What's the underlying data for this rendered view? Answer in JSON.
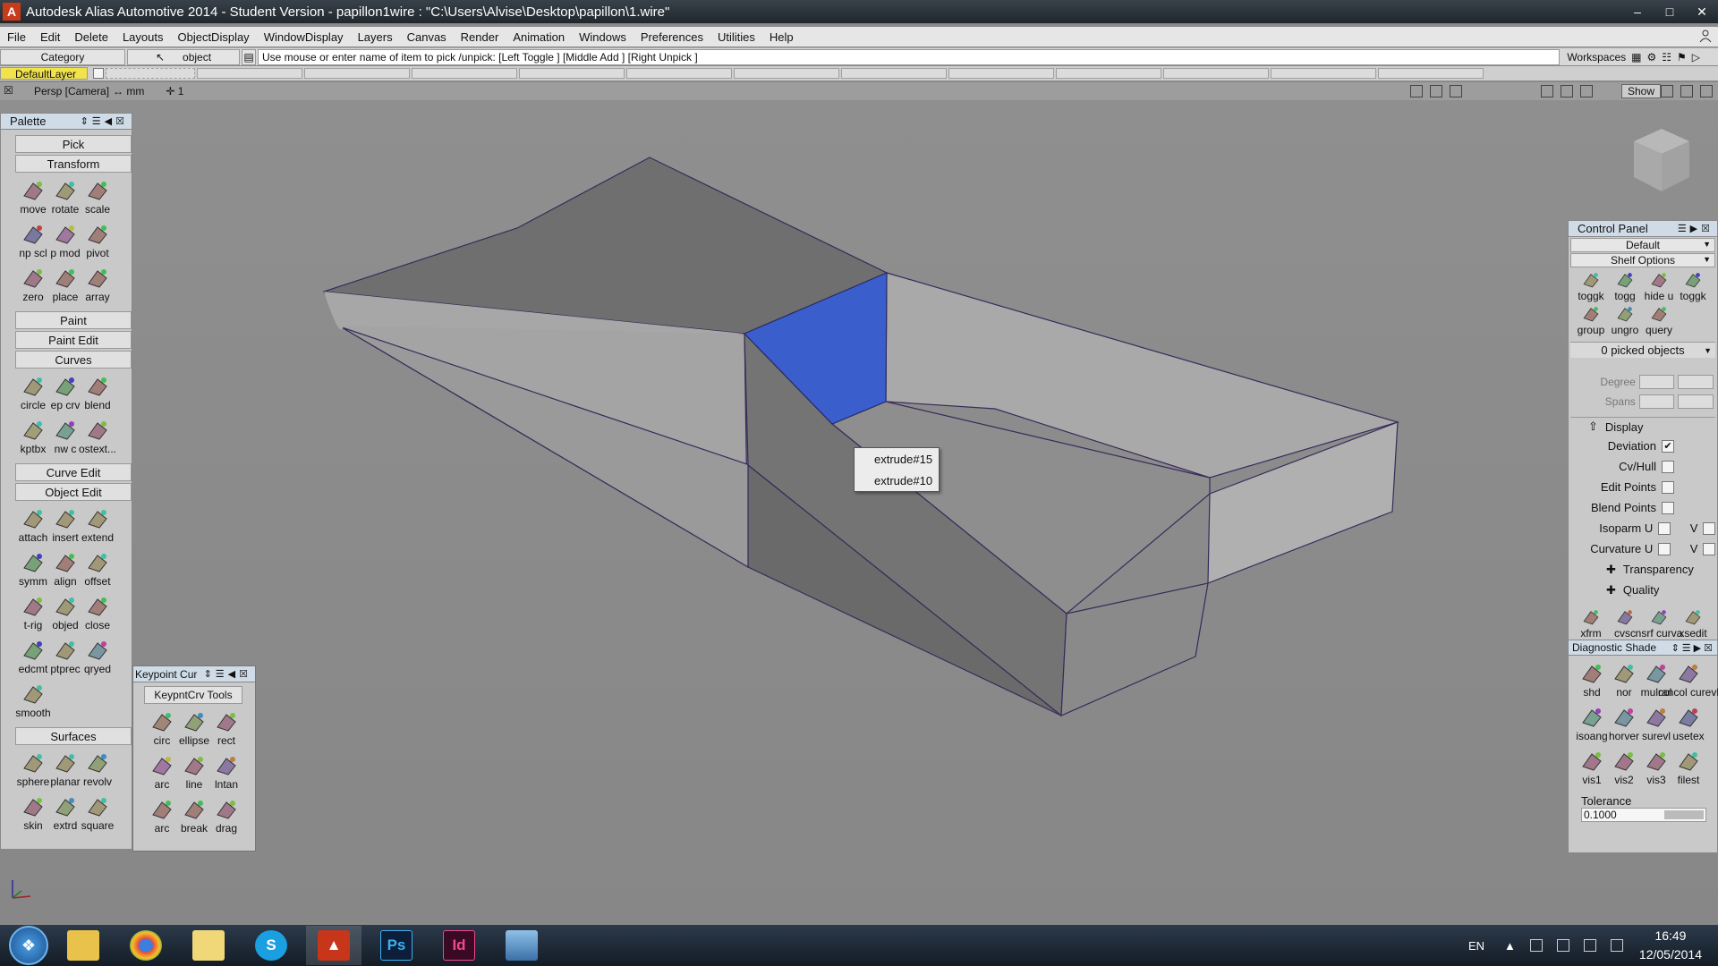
{
  "window": {
    "title": "Autodesk Alias Automotive 2014   - Student Version   - papillon1wire : \"C:\\Users\\Alvise\\Desktop\\papillon\\1.wire\"",
    "buttons": [
      "–",
      "□",
      "✕"
    ]
  },
  "menu": [
    "File",
    "Edit",
    "Delete",
    "Layouts",
    "ObjectDisplay",
    "WindowDisplay",
    "Layers",
    "Canvas",
    "Render",
    "Animation",
    "Windows",
    "Preferences",
    "Utilities",
    "Help"
  ],
  "promptbar": {
    "category": "Category",
    "object": "object",
    "prompt": "Use mouse or enter name of item to pick /unpick: [Left Toggle ] [Middle Add ] [Right Unpick ]",
    "workspaces": "Workspaces"
  },
  "layerbar": {
    "default_layer": "DefaultLayer"
  },
  "viewport": {
    "camera": "Persp [Camera]",
    "units": "↔ mm",
    "count": "✛ 1",
    "show_button": "Show"
  },
  "palette": {
    "title": "Palette",
    "pick": "Pick",
    "transform": "Transform",
    "transform_tools": [
      {
        "icon": "move-icon",
        "label": "move"
      },
      {
        "icon": "rotate-icon",
        "label": "rotate"
      },
      {
        "icon": "scale-icon",
        "label": "scale"
      },
      {
        "icon": "nonproportional-scale-icon",
        "label": "np scl"
      },
      {
        "icon": "sculpt-modify-icon",
        "label": "p mod"
      },
      {
        "icon": "pivot-icon",
        "label": "pivot"
      },
      {
        "icon": "zero-icon",
        "label": "zero"
      },
      {
        "icon": "place-icon",
        "label": "place"
      },
      {
        "icon": "array-icon",
        "label": "array"
      }
    ],
    "paint": "Paint",
    "paint_edit": "Paint Edit",
    "curves": "Curves",
    "curve_tools": [
      {
        "icon": "circle-icon",
        "label": "circle"
      },
      {
        "icon": "ep-curve-icon",
        "label": "ep crv"
      },
      {
        "icon": "blend-icon",
        "label": "blend"
      },
      {
        "icon": "keypoint-toolbox-icon",
        "label": "kptbx"
      },
      {
        "icon": "new-curve-icon",
        "label": "nw c"
      },
      {
        "icon": "text-icon",
        "label": "ostext..."
      }
    ],
    "curve_edit": "Curve Edit",
    "object_edit": "Object Edit",
    "object_tools": [
      {
        "icon": "attach-icon",
        "label": "attach"
      },
      {
        "icon": "insert-icon",
        "label": "insert"
      },
      {
        "icon": "extend-icon",
        "label": "extend"
      },
      {
        "icon": "symmetry-icon",
        "label": "symm"
      },
      {
        "icon": "align-icon",
        "label": "align"
      },
      {
        "icon": "offset-icon",
        "label": "offset"
      },
      {
        "icon": "trim-icon",
        "label": "t-rig"
      },
      {
        "icon": "object-icon",
        "label": "objed"
      },
      {
        "icon": "close-icon",
        "label": "close"
      },
      {
        "icon": "edit-cmt-icon",
        "label": "edcmt"
      },
      {
        "icon": "ptprec-icon",
        "label": "ptprec"
      },
      {
        "icon": "query-edit-icon",
        "label": "qryed"
      },
      {
        "icon": "smooth-icon",
        "label": "smooth"
      }
    ],
    "surfaces": "Surfaces",
    "surface_tools": [
      {
        "icon": "sphere-icon",
        "label": "sphere"
      },
      {
        "icon": "planar-icon",
        "label": "planar"
      },
      {
        "icon": "revolve-icon",
        "label": "revolv"
      },
      {
        "icon": "skin-icon",
        "label": "skin"
      },
      {
        "icon": "extrude-icon",
        "label": "extrd"
      },
      {
        "icon": "square-icon",
        "label": "square"
      }
    ]
  },
  "keypoint": {
    "title": "Keypoint Cur",
    "tab": "KeypntCrv Tools",
    "tools": [
      {
        "icon": "keypoint-circle-icon",
        "label": "circ"
      },
      {
        "icon": "ellipse-icon",
        "label": "ellipse"
      },
      {
        "icon": "rect-icon",
        "label": "rect"
      },
      {
        "icon": "arc-icon",
        "label": "arc"
      },
      {
        "icon": "line-icon",
        "label": "line"
      },
      {
        "icon": "line-tangent-icon",
        "label": "lntan"
      },
      {
        "icon": "arc-2-icon",
        "label": "arc"
      },
      {
        "icon": "break-icon",
        "label": "break"
      },
      {
        "icon": "drag-icon",
        "label": "drag"
      }
    ]
  },
  "popup": {
    "items": [
      "extrude#15",
      "extrude#10"
    ]
  },
  "control_panel": {
    "title": "Control Panel",
    "default": "Default",
    "shelf_options": "Shelf Options",
    "shelf_row1": [
      {
        "icon": "toggle-icon",
        "label": "toggk"
      },
      {
        "icon": "toggle-2-icon",
        "label": "togg"
      },
      {
        "icon": "hide-icon",
        "label": "hide u"
      },
      {
        "icon": "toggle-3-icon",
        "label": "toggk"
      }
    ],
    "shelf_row2": [
      {
        "icon": "group-icon",
        "label": "group"
      },
      {
        "icon": "ungroup-icon",
        "label": "ungro"
      },
      {
        "icon": "query-icon",
        "label": "query"
      }
    ],
    "picked": "0 picked objects",
    "degree": "Degree",
    "spans": "Spans",
    "display": "Display",
    "display_rows": [
      {
        "label": "Deviation",
        "checked": true
      },
      {
        "label": "Cv/Hull",
        "checked": false
      },
      {
        "label": "Edit Points",
        "checked": false
      },
      {
        "label": "Blend Points",
        "checked": false
      },
      {
        "label": "Isoparm U",
        "checked": false,
        "v": "V"
      },
      {
        "label": "Curvature U",
        "checked": false,
        "v": "V"
      }
    ],
    "transparency": "Transparency",
    "quality": "Quality",
    "tools_row": [
      {
        "icon": "xform-icon",
        "label": "xfrm"
      },
      {
        "icon": "cv-icon",
        "label": "cvsc"
      },
      {
        "icon": "curvature-icon",
        "label": "nsrf curva"
      },
      {
        "icon": "xsedit-icon",
        "label": "xsedit"
      }
    ]
  },
  "diagnostic": {
    "title": "Diagnostic Shade",
    "tools": [
      {
        "icon": "shade-icon",
        "label": "shd"
      },
      {
        "icon": "normal-icon",
        "label": "nor"
      },
      {
        "icon": "multicolor-icon",
        "label": "mulcol"
      },
      {
        "icon": "random-color-icon",
        "label": "rancol curevl"
      },
      {
        "icon": "iso-angle-icon",
        "label": "isoang"
      },
      {
        "icon": "horizontal-icon",
        "label": "horver"
      },
      {
        "icon": "surface-eval-icon",
        "label": "surevl"
      },
      {
        "icon": "use-texture-icon",
        "label": "usetex"
      },
      {
        "icon": "vis1-icon",
        "label": "vis1"
      },
      {
        "icon": "vis2-icon",
        "label": "vis2"
      },
      {
        "icon": "vis3-icon",
        "label": "vis3"
      },
      {
        "icon": "filest-icon",
        "label": "filest"
      }
    ],
    "tolerance_label": "Tolerance",
    "tolerance_value": "0.1000"
  },
  "taskbar": {
    "apps": [
      "file-explorer-icon",
      "chrome-icon",
      "folder-icon",
      "skype-icon",
      "autodesk-alias-icon",
      "photoshop-icon",
      "indesign-icon",
      "image-viewer-icon"
    ],
    "app_letters": {
      "skype": "S",
      "photoshop": "Ps",
      "indesign": "Id"
    },
    "lang": "EN",
    "time": "16:49",
    "date": "12/05/2014"
  },
  "colors": {
    "selection_blue": "#3a5fcd",
    "layer_yellow": "#f2e34a",
    "panel_title": "#cfdce8"
  }
}
